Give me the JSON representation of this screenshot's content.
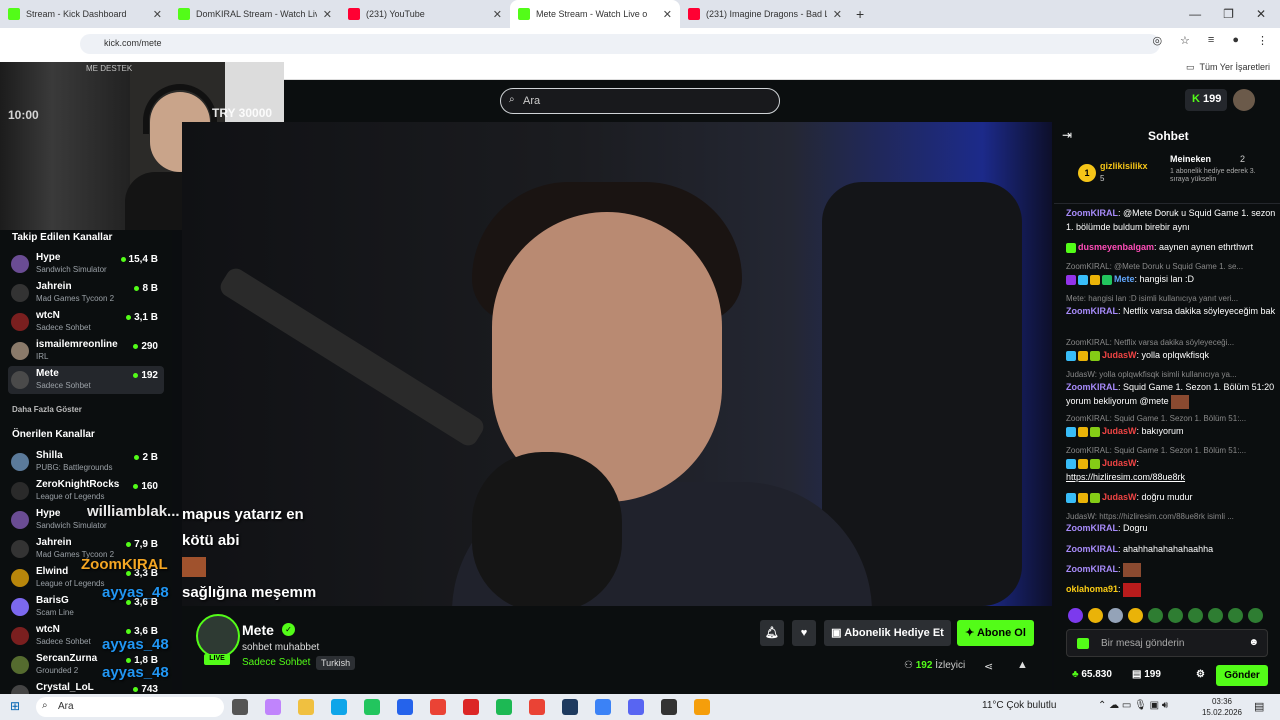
{
  "browser": {
    "tabs": [
      {
        "label": "Stream - Kick Dashboard",
        "favicon": "kick-icon"
      },
      {
        "label": "DomKIRAL Stream - Watch Live",
        "favicon": "kick-icon"
      },
      {
        "label": "(231) YouTube",
        "favicon": "youtube-icon"
      },
      {
        "label": "Mete Stream - Watch Live o",
        "favicon": "kick-icon",
        "active": true
      },
      {
        "label": "(231) Imagine Dragons - Bad Liar",
        "favicon": "youtube-icon"
      }
    ],
    "url": "kick.com/mete",
    "bookmarks_label": "Tüm Yer İşaretleri"
  },
  "kick": {
    "search_placeholder": "Ara",
    "coins": "199"
  },
  "webcam": {
    "top_text": "ME DESTEK",
    "left_overlay": "10:00",
    "right_overlay": "TRY 30000"
  },
  "sidebar": {
    "followed_title": "Takip Edilen Kanallar",
    "followed": [
      {
        "name": "Hype",
        "category": "Sandwich Simulator",
        "viewers": "15,4 B"
      },
      {
        "name": "Jahrein",
        "category": "Mad Games Tycoon 2",
        "viewers": "8 B"
      },
      {
        "name": "wtcN",
        "category": "Sadece Sohbet",
        "viewers": "3,1 B"
      },
      {
        "name": "ismailemreonline",
        "category": "IRL",
        "viewers": "290"
      },
      {
        "name": "Mete",
        "category": "Sadece Sohbet",
        "viewers": "192"
      }
    ],
    "show_more": "Daha Fazla Göster",
    "recommended_title": "Önerilen Kanallar",
    "recommended": [
      {
        "name": "Shilla",
        "category": "PUBG: Battlegrounds",
        "viewers": "2 B"
      },
      {
        "name": "ZeroKnightRocks",
        "category": "League of Legends",
        "viewers": "160"
      },
      {
        "name": "Hype",
        "category": "Sandwich Simulator",
        "viewers": ""
      },
      {
        "name": "Jahrein",
        "category": "Mad Games Tycoon 2",
        "viewers": "7,9 B"
      },
      {
        "name": "Elwind",
        "category": "League of Legends",
        "viewers": "3,3 B"
      },
      {
        "name": "BarisG",
        "category": "Scam Line",
        "viewers": "3,6 B"
      },
      {
        "name": "wtcN",
        "category": "Sadece Sohbet",
        "viewers": "3,6 B"
      },
      {
        "name": "SercanZurna",
        "category": "Grounded 2",
        "viewers": "1,8 B"
      },
      {
        "name": "Crystal_LoL",
        "category": "",
        "viewers": "743"
      }
    ]
  },
  "overlay": {
    "chat_names": [
      "williamblak...",
      "ZoomKIRAL",
      "ayyas_48",
      "ayyas_48",
      "ayyas_48"
    ],
    "subtitle_line1": "mapus yatarız en",
    "subtitle_line2": "kötü abi",
    "subtitle_line3": "sağlığına meşemm"
  },
  "streamer": {
    "name": "Mete",
    "live_label": "LIVE",
    "title": "sohbet muhabbet",
    "category": "Sadece Sohbet",
    "language": "Turkish",
    "gift_sub_label": "Abonelik Hediye Et",
    "subscribe_label": "Abone Ol",
    "viewer_count": "192",
    "viewer_label": "İzleyici"
  },
  "chat": {
    "title": "Sohbet",
    "leaderboard": {
      "first": {
        "rank": "1",
        "name": "gizlikisilikx",
        "count": "5"
      },
      "second": {
        "name": "Meineken",
        "count": "2",
        "desc": "1 abonelik hediye ederek 3. sıraya yükselin"
      }
    },
    "messages": [
      {
        "type": "msg",
        "user": "ZoomKIRAL",
        "color": "#a78bfa",
        "text": ": @Mete Doruk u Squid Game 1. sezon 1. bölümde buldum birebir aynı"
      },
      {
        "type": "msg",
        "user": "dusmeyenbalgam",
        "color": "#ff4db8",
        "text": ": aaynen aynen ethrthwrt"
      },
      {
        "type": "reply",
        "text": "ZoomKIRAL: @Mete Doruk u Squid Game 1. se..."
      },
      {
        "type": "msg",
        "user": "Mete",
        "color": "#60a5fa",
        "text": ": hangisi lan :D"
      },
      {
        "type": "reply",
        "text": "Mete: hangisi lan :D isimli kullanıcıya yanıt veri..."
      },
      {
        "type": "msg",
        "user": "ZoomKIRAL",
        "color": "#a78bfa",
        "text": ": Netflix varsa dakika söyleyeceğim bak"
      },
      {
        "type": "reply",
        "text": "ZoomKIRAL: Netflix varsa dakika söyleyeceği..."
      },
      {
        "type": "msg",
        "user": "JudasW",
        "color": "#ef4444",
        "text": ": yolla oplqwkfisqk"
      },
      {
        "type": "reply",
        "text": "JudasW: yolla oplqwkfisqk isimli kullanıcıya ya..."
      },
      {
        "type": "msg",
        "user": "ZoomKIRAL",
        "color": "#a78bfa",
        "text": ": Squid Game 1. Sezon 1. Bölüm 51:20 yorum bekliyorum @mete"
      },
      {
        "type": "reply",
        "text": "ZoomKIRAL: Squid Game 1. Sezon 1. Bölüm 51:..."
      },
      {
        "type": "msg",
        "user": "JudasW",
        "color": "#ef4444",
        "text": ": bakıyorum"
      },
      {
        "type": "reply",
        "text": "ZoomKIRAL: Squid Game 1. Sezon 1. Bölüm 51:..."
      },
      {
        "type": "msg",
        "user": "JudasW",
        "color": "#ef4444",
        "text": ":"
      },
      {
        "type": "link",
        "text": "https://hizliresim.com/88ue8rk"
      },
      {
        "type": "msg",
        "user": "JudasW",
        "color": "#ef4444",
        "text": ": doğru mudur"
      },
      {
        "type": "reply",
        "text": "JudasW: https://hizliresim.com/88ue8rk isimli ..."
      },
      {
        "type": "msg",
        "user": "ZoomKIRAL",
        "color": "#a78bfa",
        "text": ": Dogru"
      },
      {
        "type": "msg",
        "user": "ZoomKIRAL",
        "color": "#a78bfa",
        "text": ": ahahhahahahahaahha"
      },
      {
        "type": "msg",
        "user": "ZoomKIRAL",
        "color": "#a78bfa",
        "text": ":"
      },
      {
        "type": "msg",
        "user": "oklahoma91",
        "color": "#facc15",
        "text": ":"
      }
    ],
    "input_placeholder": "Bir mesaj gönderin",
    "points": "65.830",
    "subs": "199",
    "send_label": "Gönder"
  },
  "taskbar": {
    "search_label": "Ara",
    "weather": "11°C  Çok bulutlu",
    "time": "03:36",
    "date": "15.02.2026"
  }
}
